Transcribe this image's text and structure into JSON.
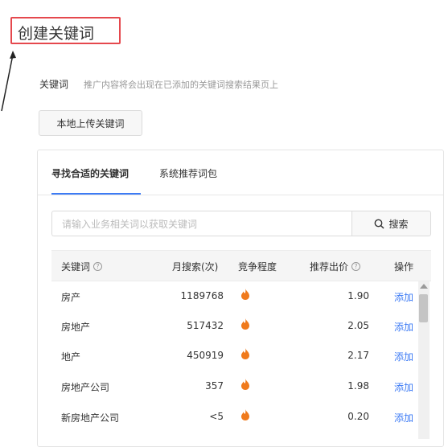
{
  "page": {
    "title": "创建关键词"
  },
  "keyword_section": {
    "label": "关键词",
    "description": "推广内容将会出现在已添加的关键词搜索结果页上",
    "upload_button": "本地上传关键词"
  },
  "tabs": [
    {
      "label": "寻找合适的关键词",
      "active": true
    },
    {
      "label": "系统推荐词包",
      "active": false
    }
  ],
  "search": {
    "placeholder": "请输入业务相关词以获取关键词",
    "button_label": "搜索"
  },
  "table": {
    "headers": [
      "关键词",
      "月搜索(次)",
      "竞争程度",
      "推荐出价",
      "操作"
    ],
    "rows": [
      {
        "keyword": "房产",
        "monthly_searches": "1189768",
        "price": "1.90",
        "action": "添加"
      },
      {
        "keyword": "房地产",
        "monthly_searches": "517432",
        "price": "2.05",
        "action": "添加"
      },
      {
        "keyword": "地产",
        "monthly_searches": "450919",
        "price": "2.17",
        "action": "添加"
      },
      {
        "keyword": "房地产公司",
        "monthly_searches": "357",
        "price": "1.98",
        "action": "添加"
      },
      {
        "keyword": "新房地产公司",
        "monthly_searches": "<5",
        "price": "0.20",
        "action": "添加"
      }
    ]
  },
  "icons": {
    "competition": "flame-icon",
    "help": "question-circle-icon",
    "search": "search-icon"
  },
  "colors": {
    "accent": "#3d7bf5",
    "flame": "#f07a1c",
    "annotation": "#e5484d"
  }
}
